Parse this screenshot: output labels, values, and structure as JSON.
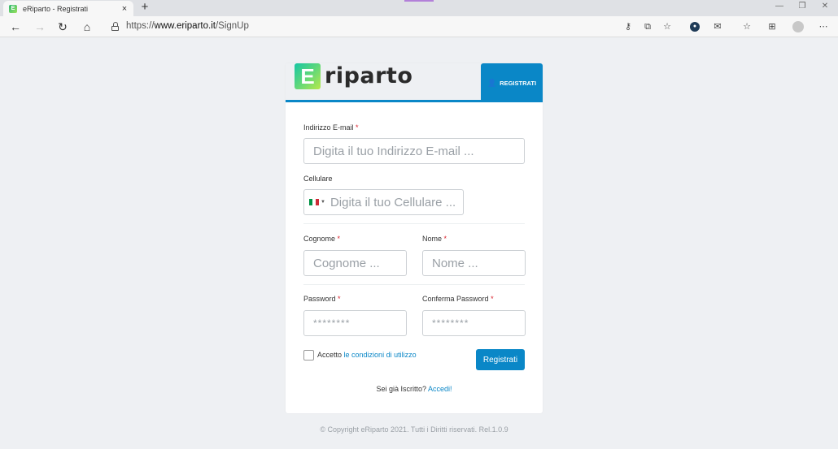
{
  "browser": {
    "tab_title": "eRiparto - Registrati",
    "tab_favicon": "E",
    "tab_close": "×",
    "new_tab": "+",
    "url_prefix": "https://",
    "url_domain": "www.eriparto.it",
    "url_path": "/SignUp",
    "icons": {
      "back": "←",
      "forward": "→",
      "reload": "↻",
      "home": "⌂",
      "key": "⚷",
      "share": "⧉",
      "favorite_add": "☆",
      "ext1": "●",
      "ext2": "✉",
      "favorites": "☆",
      "collections": "⊞",
      "profile": "",
      "more": "⋯",
      "minimize": "—",
      "restore": "❐",
      "close": "✕"
    }
  },
  "header": {
    "logo_letter": "E",
    "logo_text": "riparto",
    "tab_icon": "👤",
    "tab_label": "REGISTRATI"
  },
  "form": {
    "email_label": "Indirizzo E-mail",
    "email_placeholder": "Digita il tuo Indirizzo E-mail ...",
    "phone_label": "Cellulare",
    "phone_placeholder": "Digita il tuo Cellulare ...",
    "surname_label": "Cognome",
    "surname_placeholder": "Cognome ...",
    "name_label": "Nome",
    "name_placeholder": "Nome ...",
    "password_label": "Password",
    "password_placeholder": "********",
    "confirm_label": "Conferma Password",
    "confirm_placeholder": "********",
    "required_mark": "*",
    "accept_text": "Accetto",
    "accept_link": "le condizioni di utilizzo",
    "submit": "Registrati",
    "already_text": "Sei già Iscritto?",
    "already_link": "Accedi!"
  },
  "footer": {
    "text": "© Copyright eRiparto 2021. Tutti i Diritti riservati. Rel.1.0.9"
  },
  "colors": {
    "accent": "#0a87c7",
    "required": "#d9232e",
    "flag_green": "#009246",
    "flag_white": "#ffffff",
    "flag_red": "#ce2b37"
  }
}
